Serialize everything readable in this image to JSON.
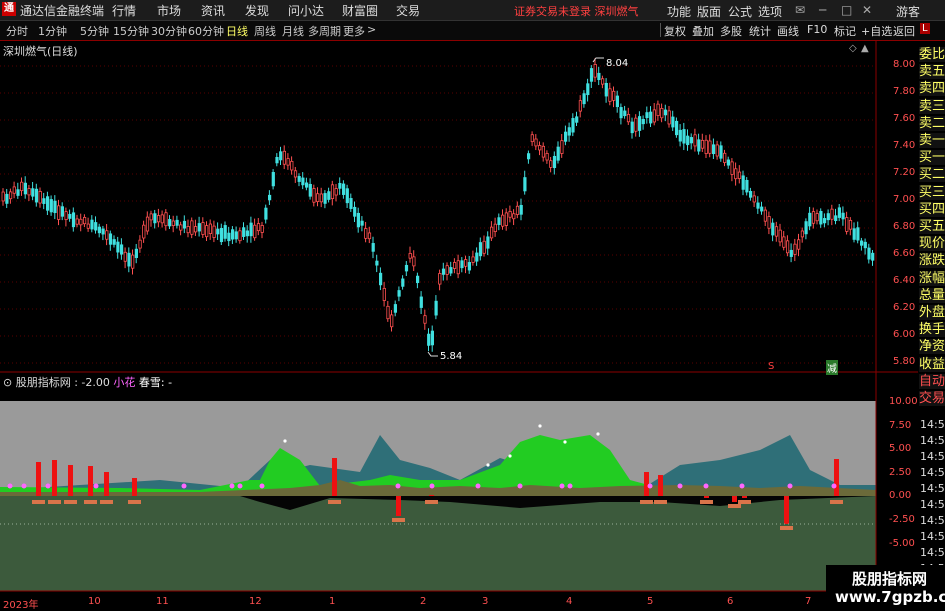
{
  "menubar": {
    "app_title": "通达信金融终端",
    "items": [
      "行情",
      "市场",
      "资讯",
      "发现",
      "问小达",
      "财富圈",
      "交易"
    ],
    "login_status": "证券交易未登录  深圳燃气",
    "right_items": [
      "功能",
      "版面",
      "公式",
      "选项"
    ],
    "guest_label": "游客"
  },
  "periodbar": {
    "tabs": [
      "分时",
      "1分钟",
      "5分钟",
      "15分钟",
      "30分钟",
      "60分钟",
      "日线",
      "周线",
      "月线",
      "多周期",
      "更多"
    ],
    "active_tab": "日线",
    "tools": [
      "复权",
      "叠加",
      "多股",
      "统计",
      "画线",
      "F10",
      "标记",
      "+自选",
      "返回"
    ]
  },
  "chart": {
    "title": "深圳燃气(日线)",
    "high_label": "8.04",
    "low_label": "5.84",
    "y_ticks": [
      "8.00",
      "7.80",
      "7.60",
      "7.40",
      "7.20",
      "7.00",
      "6.80",
      "6.60",
      "6.40",
      "6.20",
      "6.00",
      "5.80"
    ],
    "marker_s": "S",
    "marker_b": "减"
  },
  "indicator": {
    "name": "股朋指标网",
    "value1": ": -2.00",
    "label2": "小花",
    "label3": "春雪:",
    "value3": "-",
    "y_ticks": [
      "10.00",
      "7.50",
      "5.00",
      "2.50",
      "0.00",
      "-2.50",
      "-5.00"
    ]
  },
  "x_ticks": [
    "2023年",
    "10",
    "11",
    "12",
    "1",
    "2",
    "3",
    "4",
    "5",
    "6",
    "7"
  ],
  "side_panel": {
    "badge": "L",
    "items": [
      "委比",
      "卖五",
      "卖四",
      "卖三",
      "卖二",
      "卖一",
      "买一",
      "买二",
      "买三",
      "买四",
      "买五",
      "现价",
      "涨跌",
      "涨幅",
      "总量",
      "外盘",
      "换手",
      "净资",
      "收益",
      "自动",
      "交易"
    ],
    "times": [
      "14:56",
      "14:56",
      "14:56",
      "14:56",
      "14:56",
      "14:56",
      "14:56",
      "14:56",
      "14:56",
      "14:56",
      "14:56",
      "14:56"
    ]
  },
  "watermark": {
    "line1": "股朋指标网",
    "line2": "www.7gpzb.com"
  }
}
